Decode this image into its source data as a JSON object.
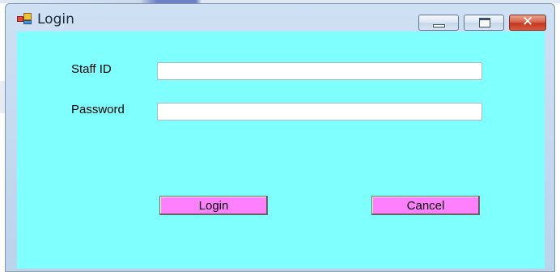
{
  "window": {
    "title": "Login",
    "icon": "form-icon",
    "controls": {
      "minimize": "minimize-icon",
      "maximize": "maximize-icon",
      "close": "close-icon"
    }
  },
  "form": {
    "staff_id_label": "Staff ID",
    "staff_id_value": "",
    "password_label": "Password",
    "password_value": "",
    "login_button": "Login",
    "cancel_button": "Cancel"
  },
  "colors": {
    "client_background": "#80ffff",
    "button_background": "#ff80ff",
    "close_button": "#c1381f"
  }
}
